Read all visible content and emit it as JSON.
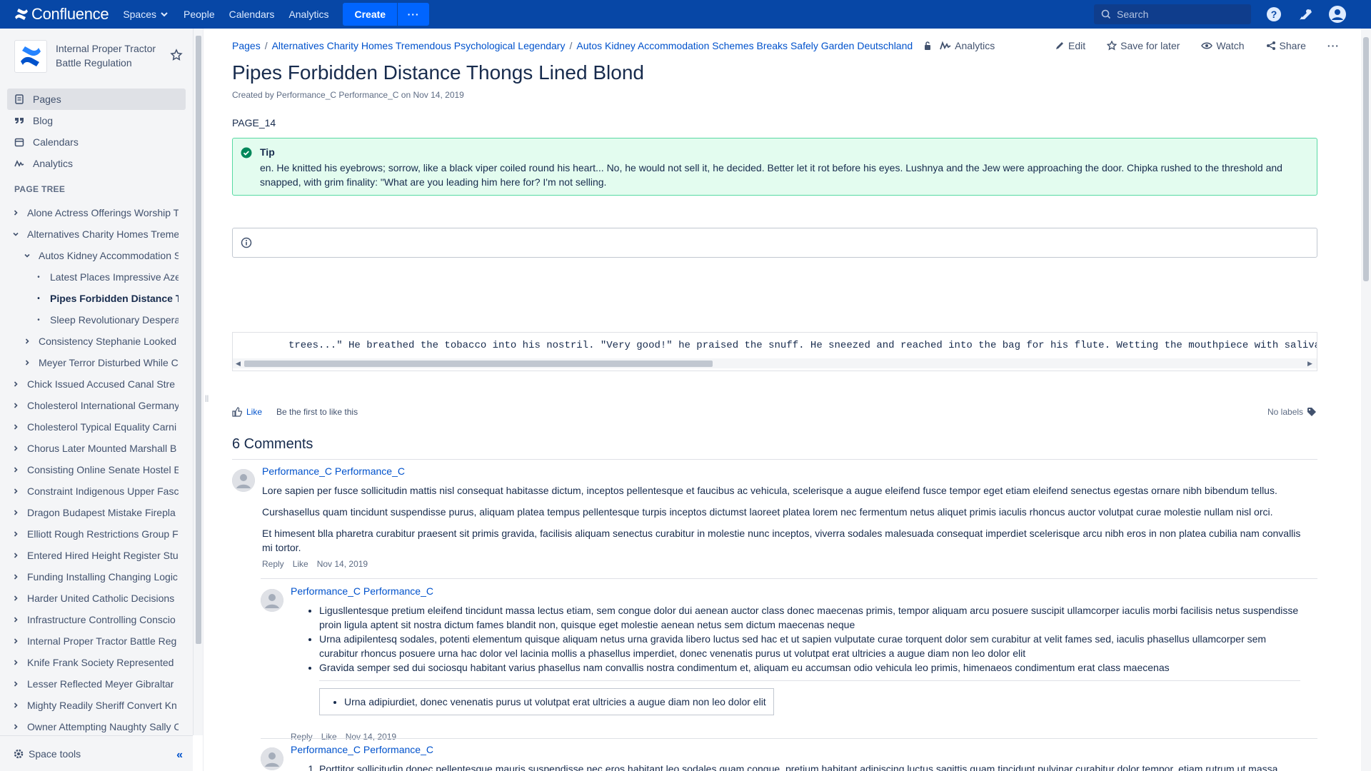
{
  "topnav": {
    "brand": "Confluence",
    "spaces": "Spaces",
    "people": "People",
    "calendars": "Calendars",
    "analytics": "Analytics",
    "create": "Create",
    "more": "···",
    "search_placeholder": "Search"
  },
  "sidebar": {
    "space_name": "Internal Proper Tractor Battle Regulation",
    "nav": [
      {
        "label": "Pages",
        "icon": "pages-icon"
      },
      {
        "label": "Blog",
        "icon": "quote-icon"
      },
      {
        "label": "Calendars",
        "icon": "calendar-icon"
      },
      {
        "label": "Analytics",
        "icon": "analytics-icon"
      }
    ],
    "page_tree_title": "PAGE TREE",
    "tree": [
      {
        "label": "Alone Actress Offerings Worship T",
        "level": 0,
        "type": "collapsed"
      },
      {
        "label": "Alternatives Charity Homes Treme",
        "level": 0,
        "type": "expanded"
      },
      {
        "label": "Autos Kidney Accommodation S",
        "level": 1,
        "type": "expanded"
      },
      {
        "label": "Latest Places Impressive Aze",
        "level": 2,
        "type": "leaf"
      },
      {
        "label": "Pipes Forbidden Distance T",
        "level": 2,
        "type": "leaf",
        "current": true
      },
      {
        "label": "Sleep Revolutionary Despera",
        "level": 2,
        "type": "leaf"
      },
      {
        "label": "Consistency Stephanie Looked",
        "level": 1,
        "type": "collapsed"
      },
      {
        "label": "Meyer Terror Disturbed While C",
        "level": 1,
        "type": "collapsed"
      },
      {
        "label": "Chick Issued Accused Canal Stre",
        "level": 0,
        "type": "collapsed"
      },
      {
        "label": "Cholesterol International Germany",
        "level": 0,
        "type": "collapsed"
      },
      {
        "label": "Cholesterol Typical Equality Carni",
        "level": 0,
        "type": "collapsed"
      },
      {
        "label": "Chorus Later Mounted Marshall B",
        "level": 0,
        "type": "collapsed"
      },
      {
        "label": "Consisting Online Senate Hostel E",
        "level": 0,
        "type": "collapsed"
      },
      {
        "label": "Constraint Indigenous Upper Fasc",
        "level": 0,
        "type": "collapsed"
      },
      {
        "label": "Dragon Budapest Mistake Firepla",
        "level": 0,
        "type": "collapsed"
      },
      {
        "label": "Elliott Rough Restrictions Group F",
        "level": 0,
        "type": "collapsed"
      },
      {
        "label": "Entered Hired Height Register Stu",
        "level": 0,
        "type": "collapsed"
      },
      {
        "label": "Funding Installing Changing Logic",
        "level": 0,
        "type": "collapsed"
      },
      {
        "label": "Harder United Catholic Decisions",
        "level": 0,
        "type": "collapsed"
      },
      {
        "label": "Infrastructure Controlling Conscio",
        "level": 0,
        "type": "collapsed"
      },
      {
        "label": "Internal Proper Tractor Battle Reg",
        "level": 0,
        "type": "collapsed"
      },
      {
        "label": "Knife Frank Society Represented",
        "level": 0,
        "type": "collapsed"
      },
      {
        "label": "Lesser Reflected Meyer Gibraltar",
        "level": 0,
        "type": "collapsed"
      },
      {
        "label": "Mighty Readily Sheriff Convert Kn",
        "level": 0,
        "type": "collapsed"
      },
      {
        "label": "Owner Attempting Naughty Sally C",
        "level": 0,
        "type": "collapsed"
      }
    ],
    "space_tools": "Space tools"
  },
  "page": {
    "breadcrumbs": [
      "Pages",
      "Alternatives Charity Homes Tremendous Psychological Legendary",
      "Autos Kidney Accommodation Schemes Breaks Safely Garden Deutschland"
    ],
    "actions": {
      "analytics": "Analytics",
      "edit": "Edit",
      "save": "Save for later",
      "watch": "Watch",
      "share": "Share"
    },
    "title": "Pipes Forbidden Distance Thongs Lined Blond",
    "byline": "Created by Performance_C Performance_C on Nov 14, 2019",
    "code": "PAGE_14",
    "tip": {
      "title": "Tip",
      "body": "en. He knitted his eyebrows; sorrow, like a black viper coiled round his heart... No, he would not sell it, he decided. Better let it rot before his eyes. Lushnya and the Jew were approaching the door. Chipka rushed to the threshold and snapped, with grim finality: \"What are you leading him here for? I'm not selling."
    },
    "codeblock": "trees...\" He breathed the tobacco into his nostril. \"Very good!\" he praised the snuff. He sneezed and reached into the bag for his flute. Wetting the mouthpiece with saliva",
    "like": "Like",
    "like_first": "Be the first to like this",
    "no_labels": "No labels"
  },
  "comments": {
    "title": "6 Comments",
    "c1": {
      "author": "Performance_C Performance_C",
      "paragraphs": [
        "Lore sapien per fusce sollicitudin mattis nisl consequat habitasse dictum, inceptos pellentesque et faucibus ac vehicula, scelerisque a augue eleifend fusce tempor eget etiam eleifend senectus egestas ornare nibh bibendum tellus.",
        "Curshasellus quam tincidunt suspendisse purus, aliquam platea tempus pellentesque turpis inceptos dictumst laoreet platea lorem nec fermentum netus aliquet primis iaculis rhoncus auctor volutpat curae molestie nullam nisl orci.",
        "Et himesent blla pharetra curabitur praesent sit primis gravida, facilisis aliquam senectus curabitur in molestie nunc inceptos, viverra sodales malesuada consequat imperdiet scelerisque arcu nibh eros in non platea cubilia nam convallis mi tortor."
      ],
      "reply": "Reply",
      "like": "Like",
      "date": "Nov 14, 2019"
    },
    "c2": {
      "author": "Performance_C Performance_C",
      "bullets": [
        "Ligusllentesque pretium eleifend tincidunt massa lectus etiam, sem congue dolor dui aenean auctor class donec maecenas primis, tempor aliquam arcu posuere suscipit ullamcorper iaculis morbi facilisis netus suspendisse proin ligula aptent sit nostra dictum fames blandit non, quisque eget molestie aenean netus sem dictum maecenas neque",
        "Urna adipilentesq sodales, potenti elementum quisque aliquam netus urna gravida libero luctus sed hac et ut sapien vulputate curae torquent dolor sem curabitur at velit fames sed, iaculis phasellus ullamcorper sem curabitur rhoncus posuere urna hac dolor vel lacinia mollis a phasellus imperdiet, donec venenatis purus ut volutpat erat ultricies a augue diam non leo dolor elit",
        "Gravida semper sed dui sociosqu habitant varius phasellus nam convallis nostra condimentum et, aliquam eu accumsan odio vehicula leo primis, himenaeos condimentum erat class maecenas"
      ],
      "boxed": "Urna adipiurdiet, donec venenatis purus ut volutpat erat ultricies a augue diam non leo dolor elit",
      "reply": "Reply",
      "like": "Like",
      "date": "Nov 14, 2019"
    },
    "c3": {
      "author": "Performance_C Performance_C",
      "first_item": "Porttitor sollicitudin donec pellentesque mauris suspendisse nec eros habitant leo sodales quam congue, pretium habitant adipiscing luctus sagittis quam tincidunt pulvinar curabitur dolor tempor, etiam rutrum ut massa"
    }
  },
  "colors": {
    "topnav": "#0747a6",
    "link": "#0052cc",
    "tip_bg": "#e3fcef",
    "tip_border": "#57d9a3",
    "sidebar_bg": "#f4f5f7"
  }
}
